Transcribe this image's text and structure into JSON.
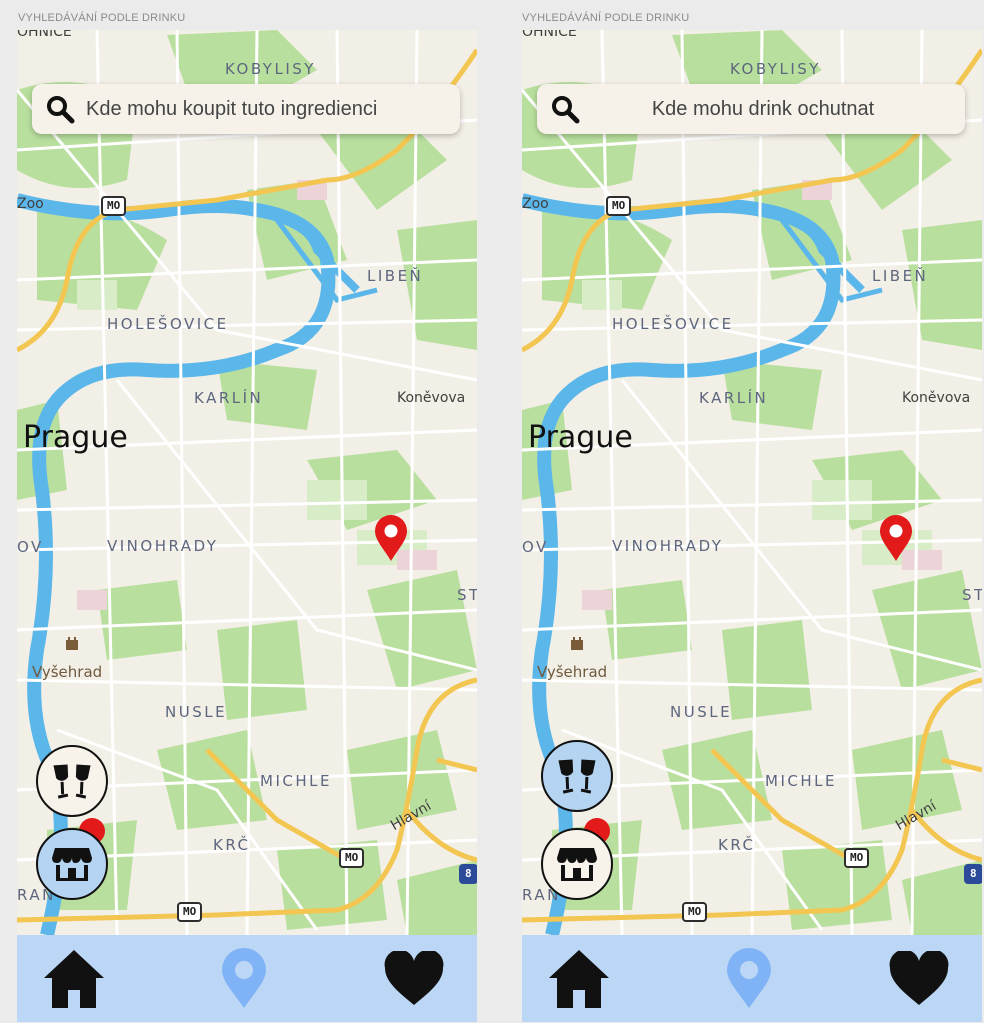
{
  "screens": [
    {
      "caption": "VYHLEDÁVÁNÍ PODLE DRINKU",
      "search_placeholder": "Kde mohu koupit tuto ingredienci",
      "active_fab": "shop"
    },
    {
      "caption": "VYHLEDÁVÁNÍ PODLE DRINKU",
      "search_placeholder": "Kde mohu drink ochutnat",
      "active_fab": "drinks"
    }
  ],
  "map": {
    "city": "Prague",
    "districts": {
      "kobylisy": "KOBYLISY",
      "holesovice": "HOLEŠOVICE",
      "liben": "LIBEŇ",
      "karlin": "KARLÍN",
      "vinohrady": "VINOHRADY",
      "nusle": "NUSLE",
      "michle": "MICHLE",
      "krc": "KRČ",
      "top_cut": "OHNICE",
      "left_cut_ov": "OV",
      "left_cut_ran": "RAN",
      "right_cut_st": "ST"
    },
    "places": {
      "zoo": "Zoo",
      "konevova": "Koněvova",
      "vysehrad": "Vyšehrad",
      "hlavni": "Hlavní"
    },
    "road_badges": {
      "mo": "MO",
      "eight": "8"
    }
  },
  "icons": {
    "search": "search-icon",
    "pin": "map-pin-icon",
    "drinks": "wine-glasses-icon",
    "shop": "store-icon",
    "home": "home-icon",
    "location": "location-pin-icon",
    "favorites": "heart-icon"
  },
  "colors": {
    "nav_bar": "#bcd7f5",
    "fab_active": "#b4d4f2",
    "pin_red": "#e21a1a",
    "water": "#5bb6ea",
    "park": "#b6dd9b",
    "road_major": "#f3c651",
    "location_icon": "#7fb3f5"
  }
}
